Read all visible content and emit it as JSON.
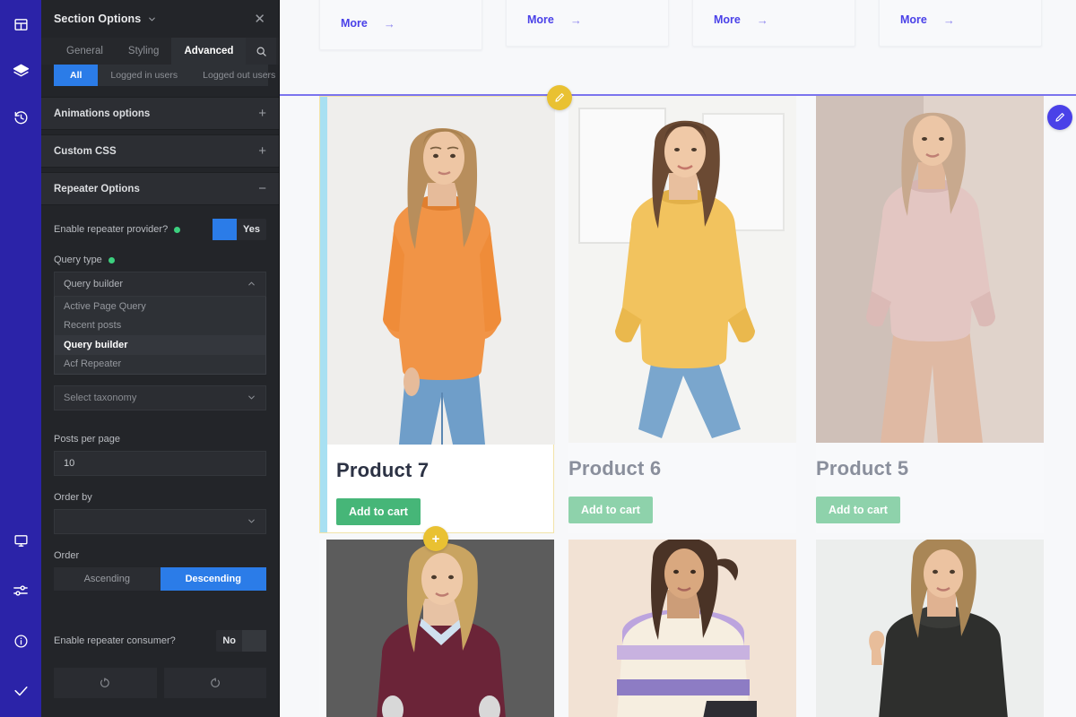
{
  "rail": {
    "top_items": [
      {
        "name": "layout-icon",
        "label": "Layout"
      },
      {
        "name": "layers-icon",
        "label": "Layers"
      },
      {
        "name": "history-icon",
        "label": "History"
      }
    ],
    "bottom_items": [
      {
        "name": "desktop-preview-icon",
        "label": "Responsive preview"
      },
      {
        "name": "sliders-icon",
        "label": "Global settings"
      },
      {
        "name": "info-icon",
        "label": "Info"
      },
      {
        "name": "check-icon",
        "label": "Save"
      }
    ],
    "accent_color": "#2b23a8"
  },
  "panel": {
    "title": "Section Options",
    "close_label": "✕",
    "tabs": [
      {
        "label": "General",
        "active": false
      },
      {
        "label": "Styling",
        "active": false
      },
      {
        "label": "Advanced",
        "active": true
      }
    ],
    "search_icon": "search-icon",
    "subtabs": [
      {
        "label": "All",
        "active": true
      },
      {
        "label": "Logged in users",
        "active": false
      },
      {
        "label": "Logged out users",
        "active": false
      }
    ],
    "accordions": [
      {
        "label": "Animations options",
        "sign": "+",
        "open": false
      },
      {
        "label": "Custom CSS",
        "sign": "+",
        "open": false
      },
      {
        "label": "Repeater Options",
        "sign": "−",
        "open": true
      }
    ],
    "repeater": {
      "enable_provider": {
        "label": "Enable repeater provider?",
        "value": "Yes",
        "state": "on"
      },
      "query_type": {
        "label": "Query type",
        "value": "Query builder",
        "expanded": true,
        "options": [
          {
            "label": "Active Page Query",
            "selected": false
          },
          {
            "label": "Recent posts",
            "selected": false
          },
          {
            "label": "Query builder",
            "selected": true
          },
          {
            "label": "Acf Repeater",
            "selected": false
          }
        ]
      },
      "taxonomy": {
        "placeholder": "Select taxonomy",
        "value": "Select taxonomy"
      },
      "posts_per_page": {
        "label": "Posts per page",
        "value": "10"
      },
      "order_by": {
        "label": "Order by",
        "value": ""
      },
      "order": {
        "label": "Order",
        "options": [
          {
            "label": "Ascending",
            "active": false
          },
          {
            "label": "Descending",
            "active": true
          }
        ]
      },
      "enable_consumer": {
        "label": "Enable repeater consumer?",
        "value": "No",
        "state": "off"
      },
      "actions": [
        {
          "name": "undo-button",
          "icon": "undo-icon"
        },
        {
          "name": "redo-button",
          "icon": "redo-icon"
        }
      ]
    },
    "accent_blue": "#2b7ce8",
    "status_dot_color": "#3cd07e"
  },
  "canvas": {
    "more_cards": [
      {
        "label": "More",
        "arrow": "→"
      },
      {
        "label": "More",
        "arrow": "→"
      },
      {
        "label": "More",
        "arrow": "→"
      },
      {
        "label": "More",
        "arrow": "→"
      }
    ],
    "products_row1": [
      {
        "name": "Product 7",
        "cart_label": "Add to cart",
        "selected": true,
        "image": "woman-in-orange-knit-sweater-and-blue-jeans"
      },
      {
        "name": "Product 6",
        "cart_label": "Add to cart",
        "selected": false,
        "image": "woman-in-yellow-oversized-sweater-and-jeans"
      },
      {
        "name": "Product 5",
        "cart_label": "Add to cart",
        "selected": false,
        "image": "woman-in-pink-sweater-and-beige-wide-trousers"
      }
    ],
    "products_row2": [
      {
        "image": "woman-in-burgundy-sweater-on-grey-backdrop"
      },
      {
        "image": "woman-in-striped-lilac-and-cream-sweater"
      },
      {
        "image": "woman-in-black-textured-collar-top"
      }
    ],
    "badges": [
      {
        "name": "edit-section-badge",
        "icon": "pencil-icon",
        "color": "#e9c132"
      },
      {
        "name": "edit-element-badge",
        "icon": "pencil-icon",
        "color": "#4a41e8"
      },
      {
        "name": "add-element-badge",
        "icon": "plus-icon",
        "color": "#e9c132"
      }
    ],
    "selection_rule_color": "#7b74ee",
    "cart_button_color": "#8ed2ab",
    "cart_button_color_active": "#46b678"
  }
}
